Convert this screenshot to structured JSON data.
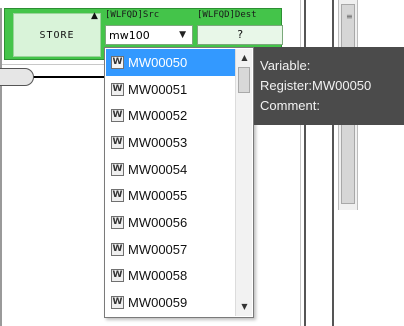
{
  "instruction": {
    "name": "STORE",
    "source_header": "[WLFQD]Src",
    "dest_header": "[WLFQD]Dest",
    "source_value": "mw100",
    "dest_value": "?"
  },
  "autocomplete": {
    "items": [
      {
        "label": "MW00050",
        "icon": "W"
      },
      {
        "label": "MW00051",
        "icon": "W"
      },
      {
        "label": "MW00052",
        "icon": "W"
      },
      {
        "label": "MW00053",
        "icon": "W"
      },
      {
        "label": "MW00054",
        "icon": "W"
      },
      {
        "label": "MW00055",
        "icon": "W"
      },
      {
        "label": "MW00056",
        "icon": "W"
      },
      {
        "label": "MW00057",
        "icon": "W"
      },
      {
        "label": "MW00058",
        "icon": "W"
      },
      {
        "label": "MW00059",
        "icon": "W"
      }
    ],
    "selected_index": 0
  },
  "tooltip": {
    "variable": "Variable:",
    "register": "Register:MW00050",
    "comment": "Comment:"
  },
  "colors": {
    "instruction_block": "#44c44a",
    "selection": "#3399ff",
    "tooltip_bg": "#4b4b4b"
  }
}
